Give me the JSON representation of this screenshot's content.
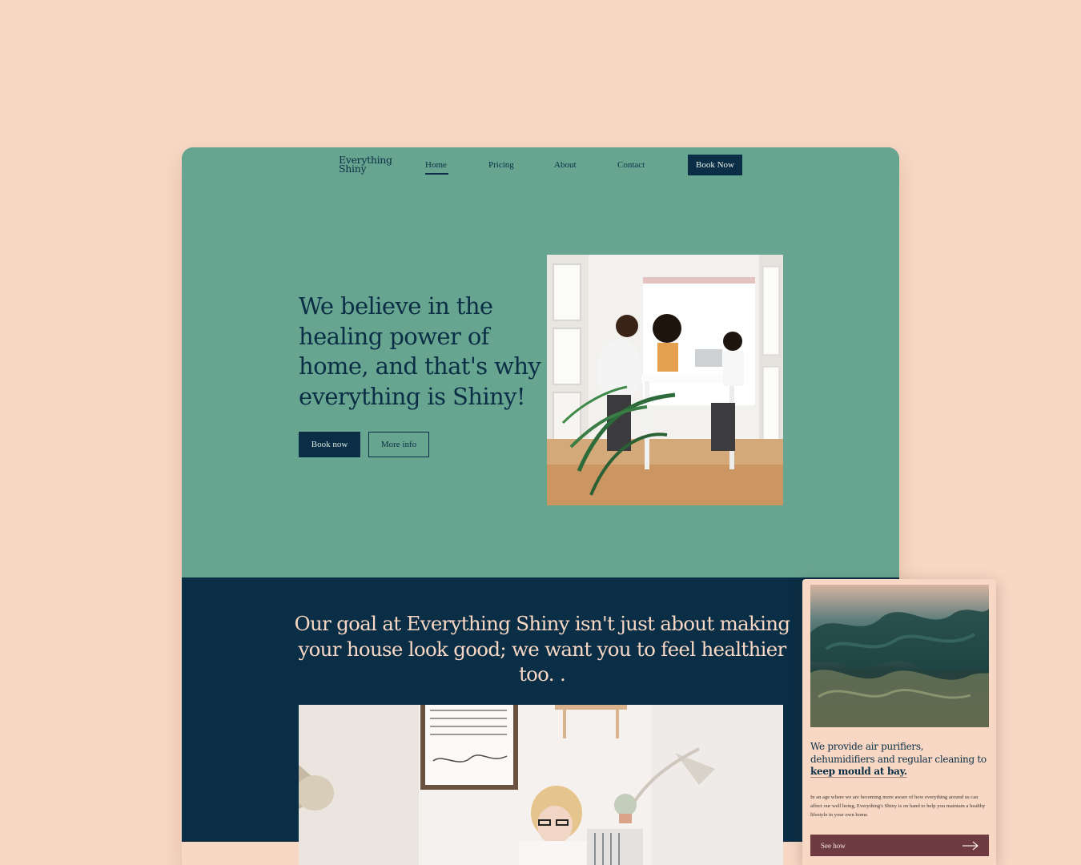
{
  "brand": {
    "line1": "Everything",
    "line2": "Shiny"
  },
  "nav": {
    "items": [
      {
        "label": "Home",
        "active": true
      },
      {
        "label": "Pricing",
        "active": false
      },
      {
        "label": "About",
        "active": false
      },
      {
        "label": "Contact",
        "active": false
      }
    ],
    "cta": "Book Now"
  },
  "hero": {
    "headline": "We believe in the healing power of home, and that's why everything is Shiny!",
    "primary_button": "Book now",
    "secondary_button": "More info"
  },
  "goal": {
    "text": "Our goal at Everything Shiny isn't just about making your house look good; we want you to feel healthier too. ."
  },
  "mobile_card": {
    "heading_plain": "We provide air purifiers, dehumidifiers and regular cleaning to ",
    "heading_bold": "keep mould at bay.",
    "body": "In an age where we are becoming more aware of how everything around us can affect our well being, Everything's Shiny is on hand to help you maintain a healthy lifestyle in your own home.",
    "button": "See how",
    "button_icon": "arrow-right-icon"
  },
  "colors": {
    "page_bg": "#f8d8c5",
    "hero_bg": "#68a591",
    "navy": "#0a2e45",
    "plum": "#6e3b40"
  }
}
